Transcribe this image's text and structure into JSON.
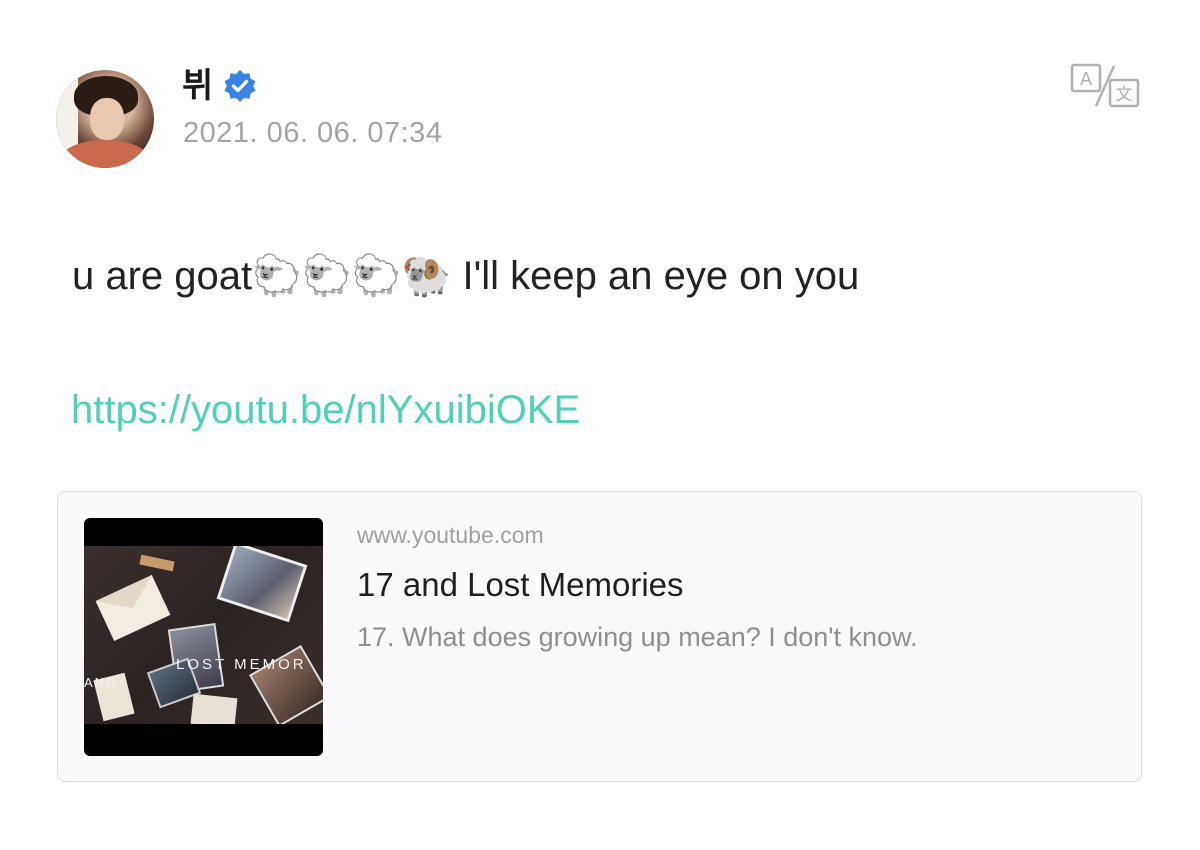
{
  "author": {
    "name": "뷔",
    "timestamp": "2021. 06. 06. 07:34",
    "verified": true
  },
  "icons": {
    "verified": "verified-badge-icon",
    "translate": "translate-icon"
  },
  "post": {
    "text_before": "u are goat",
    "emojis": "🐑🐑🐑🐏",
    "text_after": " I'll keep an eye on you",
    "link": "https://youtu.be/nlYxuibiOKE"
  },
  "link_card": {
    "domain": "www.youtube.com",
    "title": "17 and Lost Memories",
    "description": "17. What does growing up mean? I don't know.",
    "thumbnail_text_1": "LOST MEMOR",
    "thumbnail_text_2": "AND"
  },
  "colors": {
    "link": "#4fd1b8",
    "verified": "#3b82e6",
    "timestamp": "#a3a3a3",
    "card_background": "#fafafc"
  }
}
